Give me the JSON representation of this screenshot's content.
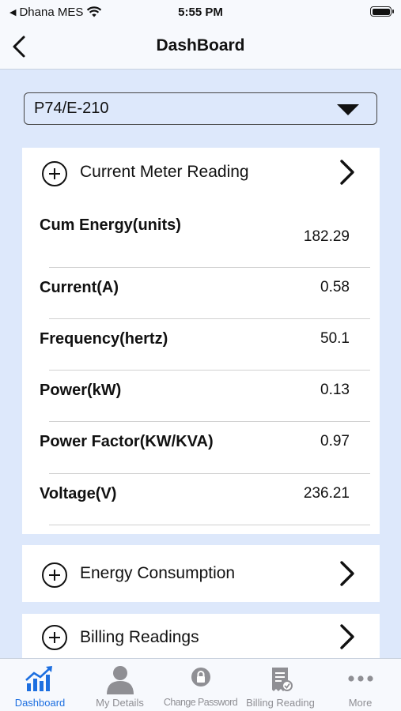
{
  "status": {
    "carrier": "Dhana MES",
    "time": "5:55 PM"
  },
  "nav": {
    "title": "DashBoard"
  },
  "meter_select": {
    "value": "P74/E-210"
  },
  "current_reading": {
    "title": "Current Meter Reading",
    "rows": [
      {
        "label": "Cum Energy(units)",
        "value": "182.29"
      },
      {
        "label": "Current(A)",
        "value": "0.58"
      },
      {
        "label": "Frequency(hertz)",
        "value": "50.1"
      },
      {
        "label": "Power(kW)",
        "value": "0.13"
      },
      {
        "label": "Power Factor(KW/KVA)",
        "value": "0.97"
      },
      {
        "label": "Voltage(V)",
        "value": "236.21"
      }
    ]
  },
  "energy_consumption": {
    "title": "Energy Consumption"
  },
  "billing_readings": {
    "title": "Billing Readings"
  },
  "tabs": [
    {
      "label": "Dashboard",
      "icon": "chart-icon",
      "active": true
    },
    {
      "label": "My Details",
      "icon": "person-icon",
      "active": false
    },
    {
      "label": "Change Password",
      "icon": "lock-icon",
      "active": false
    },
    {
      "label": "Billing Reading",
      "icon": "receipt-icon",
      "active": false
    },
    {
      "label": "More",
      "icon": "more-icon",
      "active": false
    }
  ],
  "colors": {
    "accent": "#1d6fe0",
    "background": "#dde8fb",
    "inactive": "#8f8f94"
  }
}
